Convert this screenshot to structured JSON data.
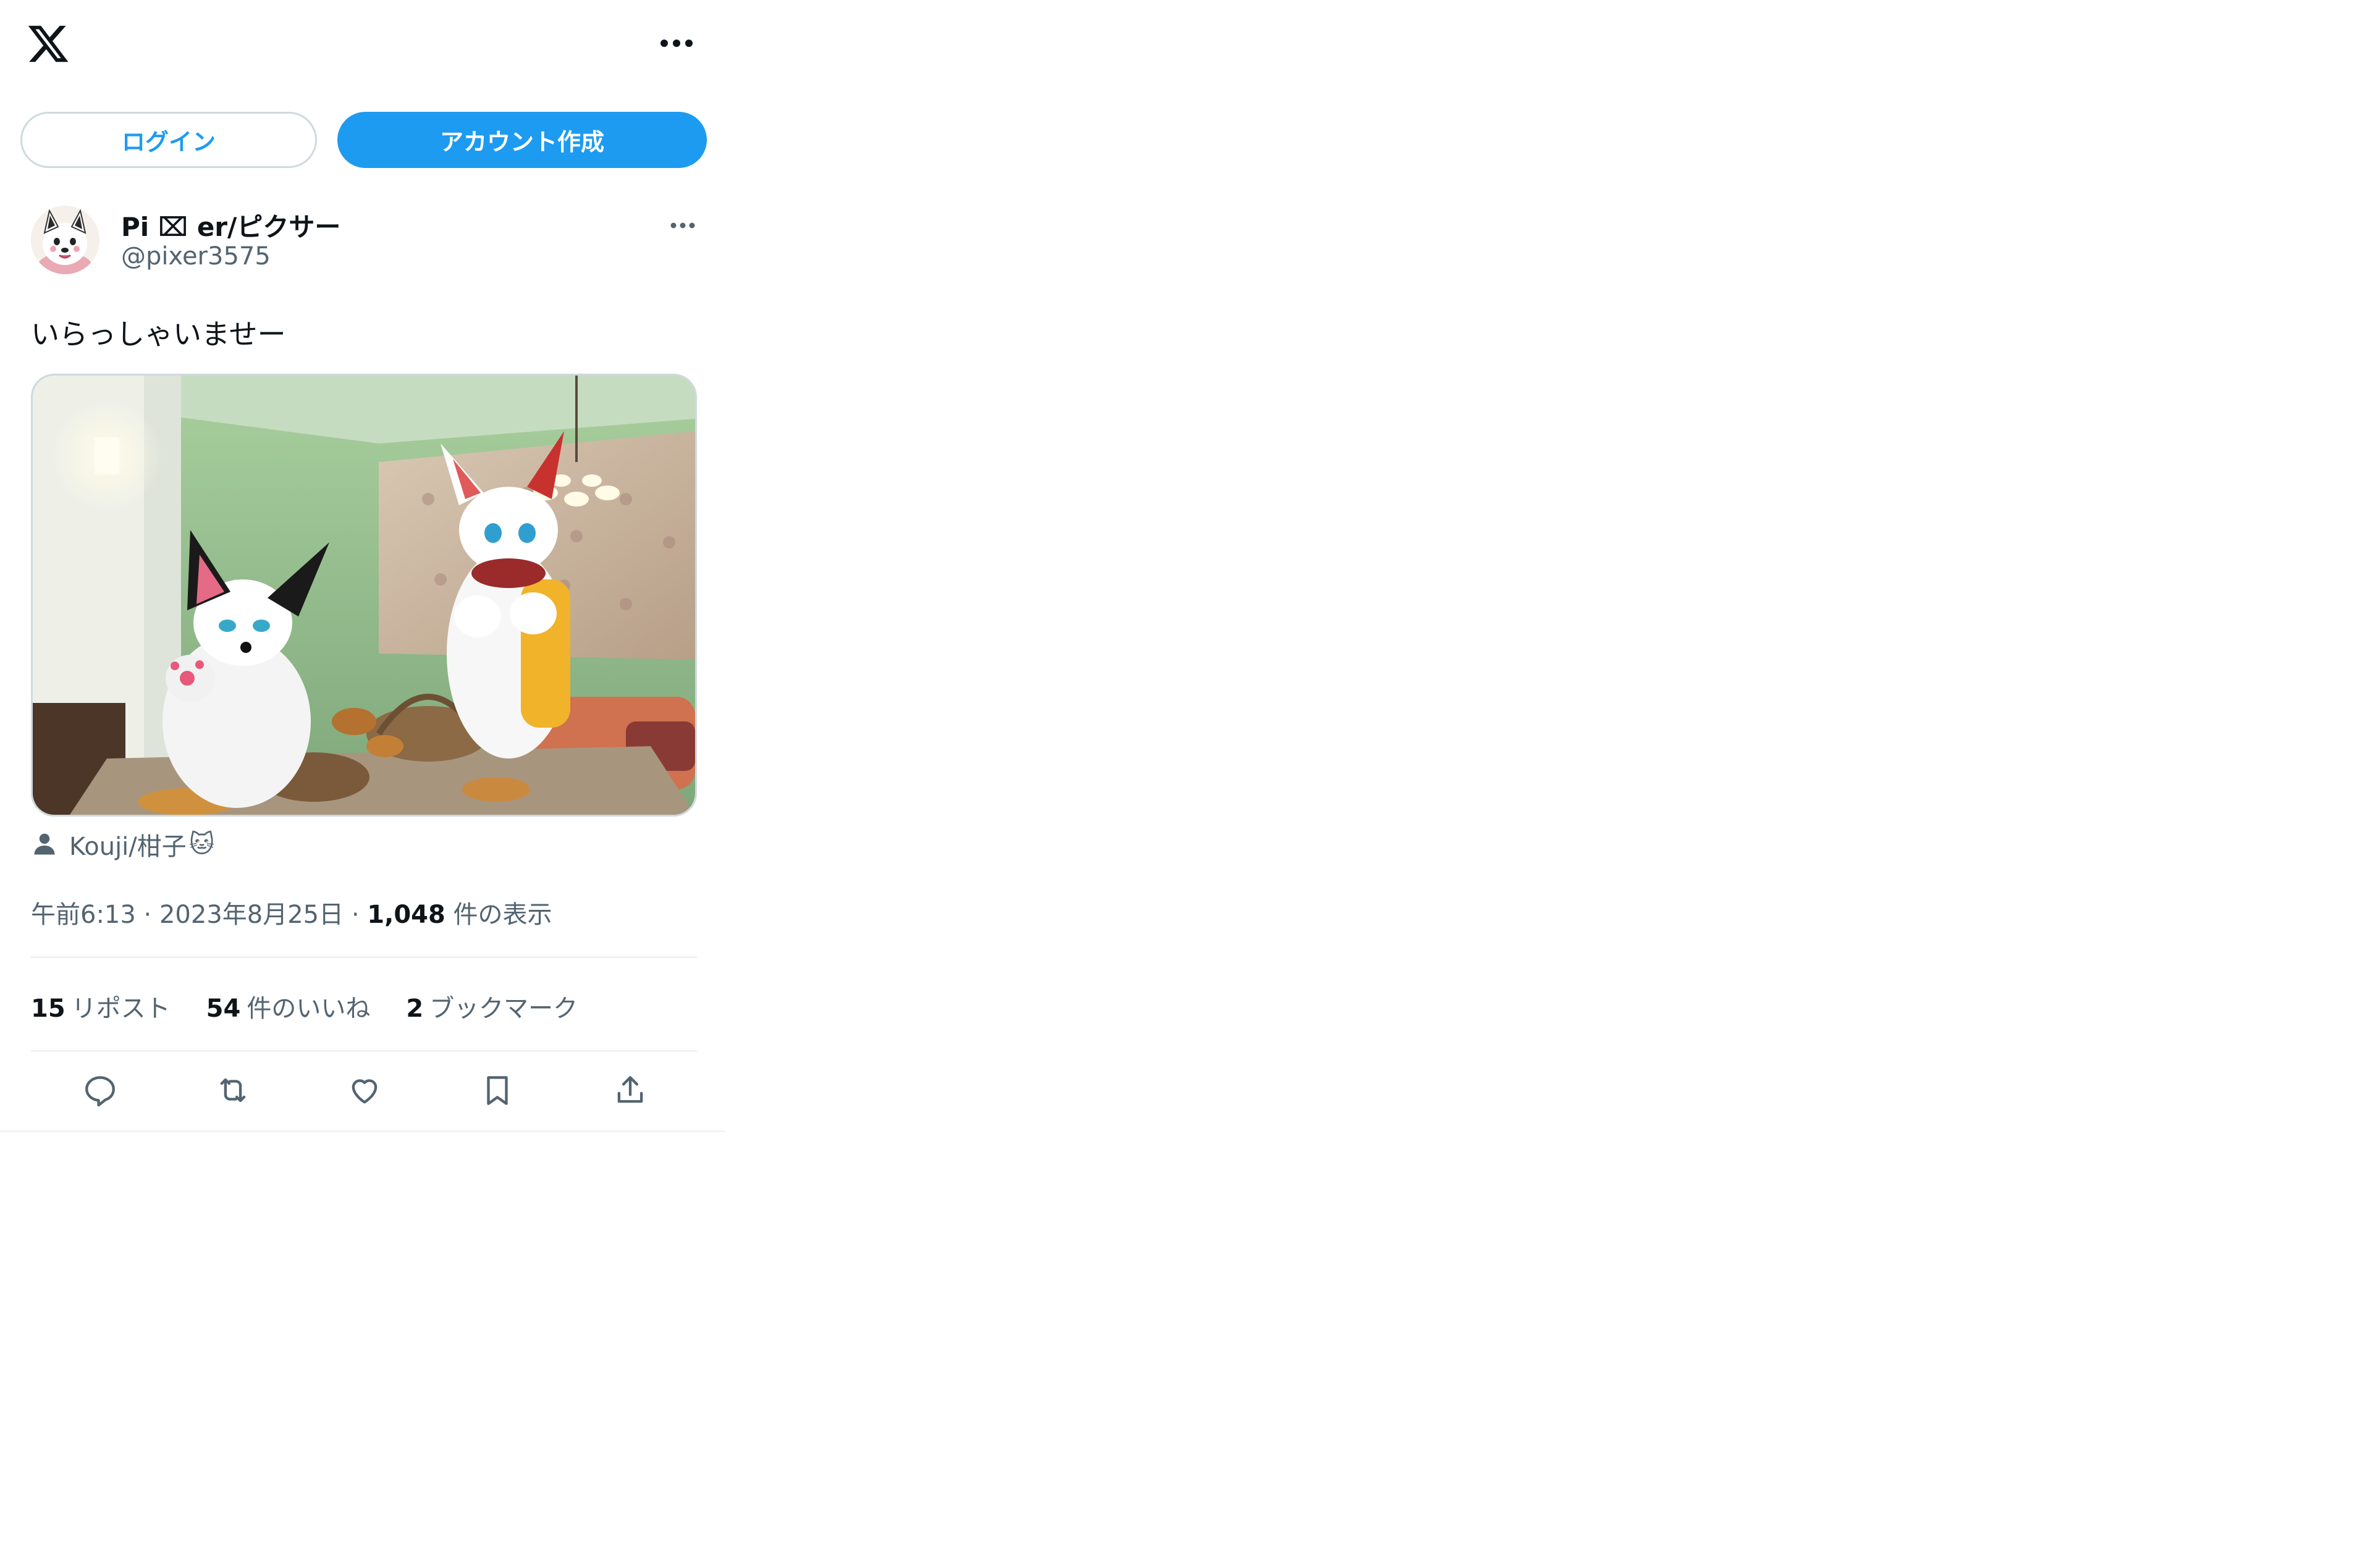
{
  "header": {
    "logo_icon": "x-logo-icon",
    "more_icon": "more-horizontal-icon"
  },
  "auth": {
    "login_label": "ログイン",
    "signup_label": "アカウント作成"
  },
  "tweet": {
    "author_name": "Pi ⌧ er/ピクサー",
    "author_handle": "@pixer3575",
    "text": "いらっしゃいませー",
    "media_credit": "Kouji/柑子",
    "media_credit_emoji": "🐱",
    "time": "午前6:13",
    "separator": "·",
    "date": "2023年8月25日",
    "views_count": "1,048",
    "views_label": "件の表示",
    "reposts_count": "15",
    "reposts_label": "リポスト",
    "likes_count": "54",
    "likes_label": "件のいいね",
    "bookmarks_count": "2",
    "bookmarks_label": "ブックマーク"
  },
  "actions": [
    "reply-icon",
    "repost-icon",
    "like-icon",
    "bookmark-icon",
    "share-icon"
  ],
  "colors": {
    "accent": "#1d9bf0",
    "text_primary": "#0f1419",
    "text_secondary": "#536471",
    "border": "#cfd9de",
    "divider": "#eff3f4"
  }
}
